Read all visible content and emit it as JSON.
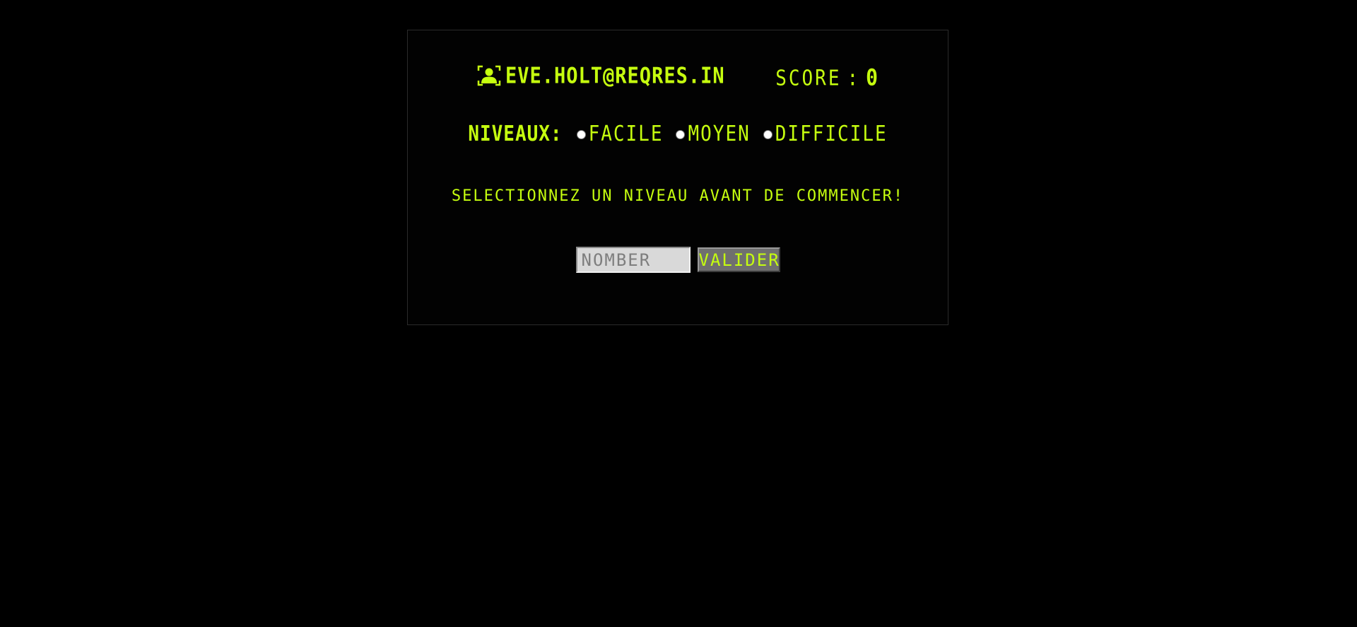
{
  "header": {
    "user_email": "eve.holt@reqres.in",
    "user_icon": "user-portrait-icon",
    "score_label": "SCORE",
    "score_separator": ":",
    "score_value": "0"
  },
  "levels": {
    "title": "NIVEAUX:",
    "options": [
      {
        "label": "FACILE",
        "selected": false
      },
      {
        "label": "MOYEN",
        "selected": false
      },
      {
        "label": "DIFFICILE",
        "selected": false
      }
    ]
  },
  "message": "SELECTIONNEZ UN NIVEAU AVANT DE COMMENCER!",
  "guess": {
    "placeholder": "NOMBER",
    "value": "",
    "submit_label": "VALIDER"
  },
  "colors": {
    "background": "#000000",
    "accent": "#c6ff0f",
    "panel_border": "#2a2a2a",
    "input_bg": "#d9d9d9",
    "button_bg": "#6f6f6f"
  }
}
